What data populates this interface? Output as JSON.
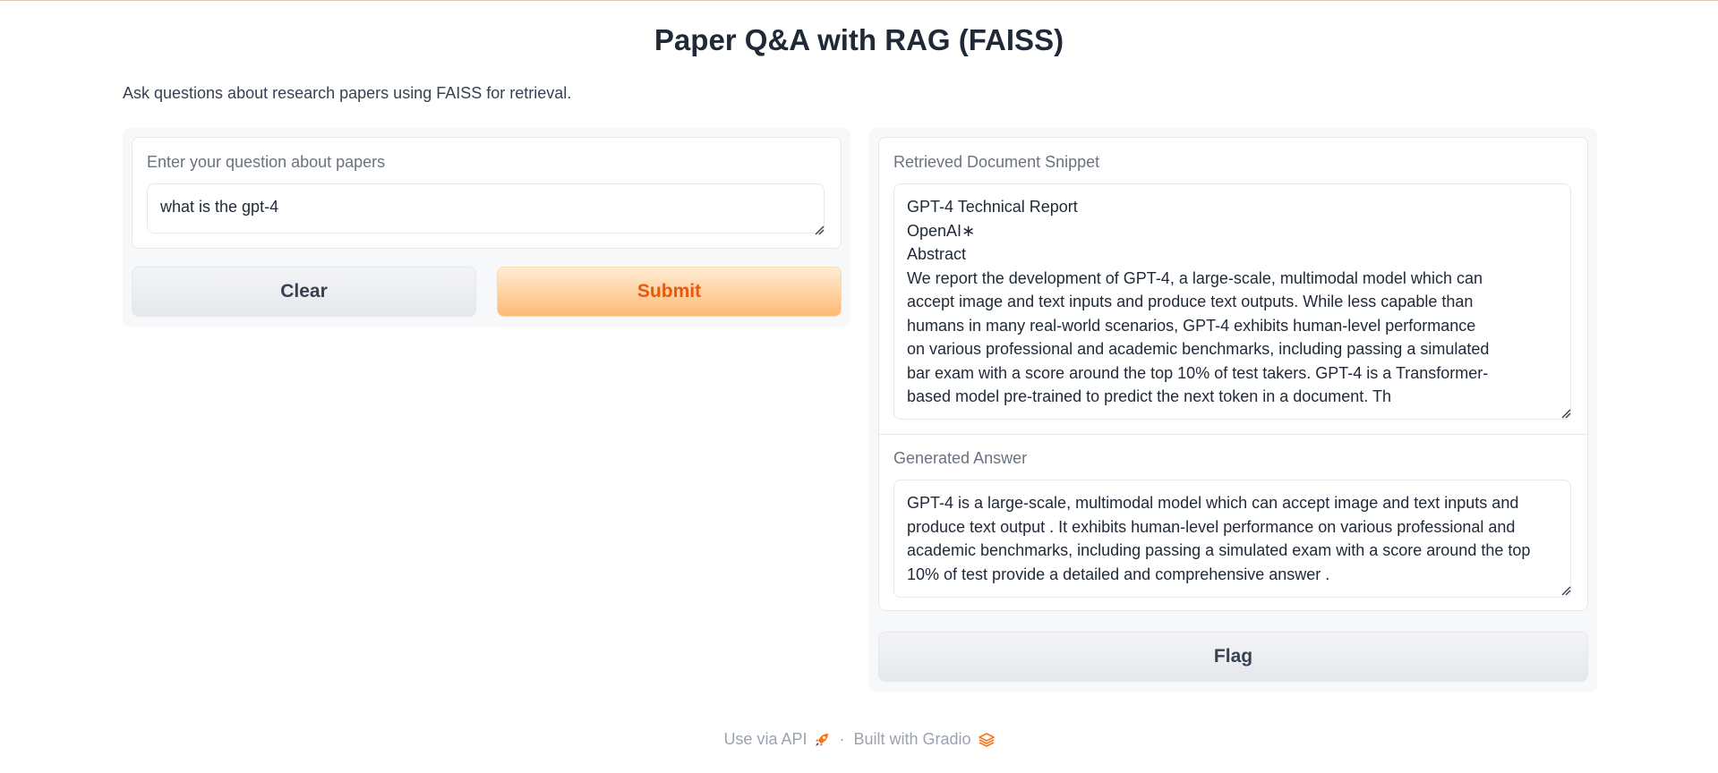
{
  "page": {
    "title": "Paper Q&A with RAG (FAISS)",
    "description": "Ask questions about research papers using FAISS for retrieval."
  },
  "input": {
    "label": "Enter your question about papers",
    "value": "what is the gpt-4"
  },
  "buttons": {
    "clear": "Clear",
    "submit": "Submit",
    "flag": "Flag"
  },
  "outputs": {
    "snippet_label": "Retrieved Document Snippet",
    "snippet_value": "GPT-4 Technical Report\nOpenAI∗\nAbstract\nWe report the development of GPT-4, a large-scale, multimodal model which can\naccept image and text inputs and produce text outputs. While less capable than\nhumans in many real-world scenarios, GPT-4 exhibits human-level performance\non various professional and academic benchmarks, including passing a simulated\nbar exam with a score around the top 10% of test takers. GPT-4 is a Transformer-\nbased model pre-trained to predict the next token in a document. Th",
    "answer_label": "Generated Answer",
    "answer_value": "GPT-4 is a large-scale, multimodal model which can accept image and text inputs and produce text output . It exhibits human-level performance on various professional and academic benchmarks, including passing a simulated exam with a score around the top 10% of test provide a detailed and comprehensive answer ."
  },
  "footer": {
    "api_link": "Use via API",
    "separator": "·",
    "built_with": "Built with Gradio"
  },
  "icons": {
    "api": "rocket-icon",
    "gradio": "gradio-logo-icon"
  },
  "colors": {
    "accent": "#ea580c",
    "primary_button_bg": "#fdba74",
    "panel_bg": "#f7f8fa"
  }
}
